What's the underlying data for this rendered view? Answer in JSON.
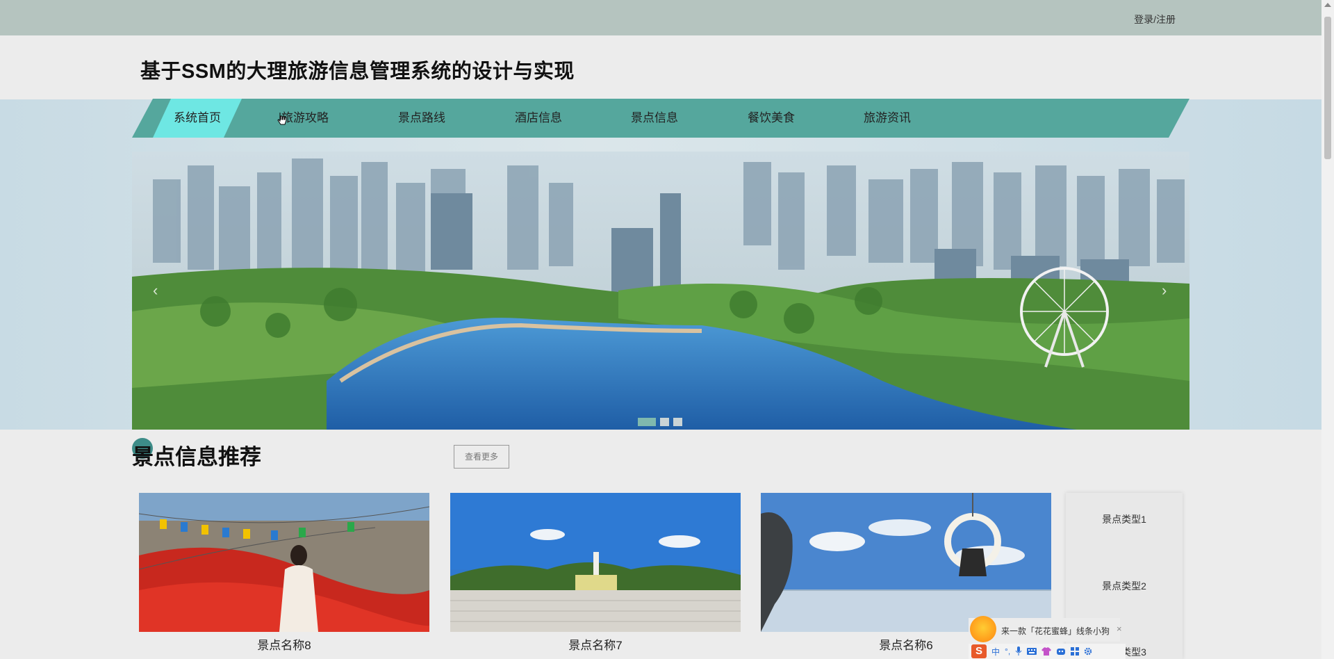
{
  "topbar": {
    "login_label": "登录/注册"
  },
  "header": {
    "site_title": "基于SSM的大理旅游信息管理系统的设计与实现"
  },
  "nav": {
    "items": [
      {
        "label": "系统首页",
        "active": true
      },
      {
        "label": "旅游攻略",
        "active": false
      },
      {
        "label": "景点路线",
        "active": false
      },
      {
        "label": "酒店信息",
        "active": false
      },
      {
        "label": "景点信息",
        "active": false
      },
      {
        "label": "餐饮美食",
        "active": false
      },
      {
        "label": "旅游资讯",
        "active": false
      }
    ]
  },
  "banner": {
    "prev_arrow": "‹",
    "next_arrow": "›",
    "slide_count": 3,
    "active_slide": 1
  },
  "section": {
    "title": "景点信息推荐",
    "more_label": "查看更多"
  },
  "cards": [
    {
      "name": "景点名称8"
    },
    {
      "name": "景点名称7"
    },
    {
      "name": "景点名称6"
    }
  ],
  "side_panel": {
    "items": [
      "景点类型1",
      "景点类型2",
      "景点类型3"
    ]
  },
  "ime": {
    "bubble_text": "来一款「花花蜜蜂」线条小狗",
    "close": "×",
    "logo": "S",
    "mode": "中",
    "punct": "°,"
  },
  "colors": {
    "nav_bg": "#55a79d",
    "nav_active": "#6ee7e3",
    "topbar": "#b5c4bf",
    "accent": "#3d8c88"
  }
}
